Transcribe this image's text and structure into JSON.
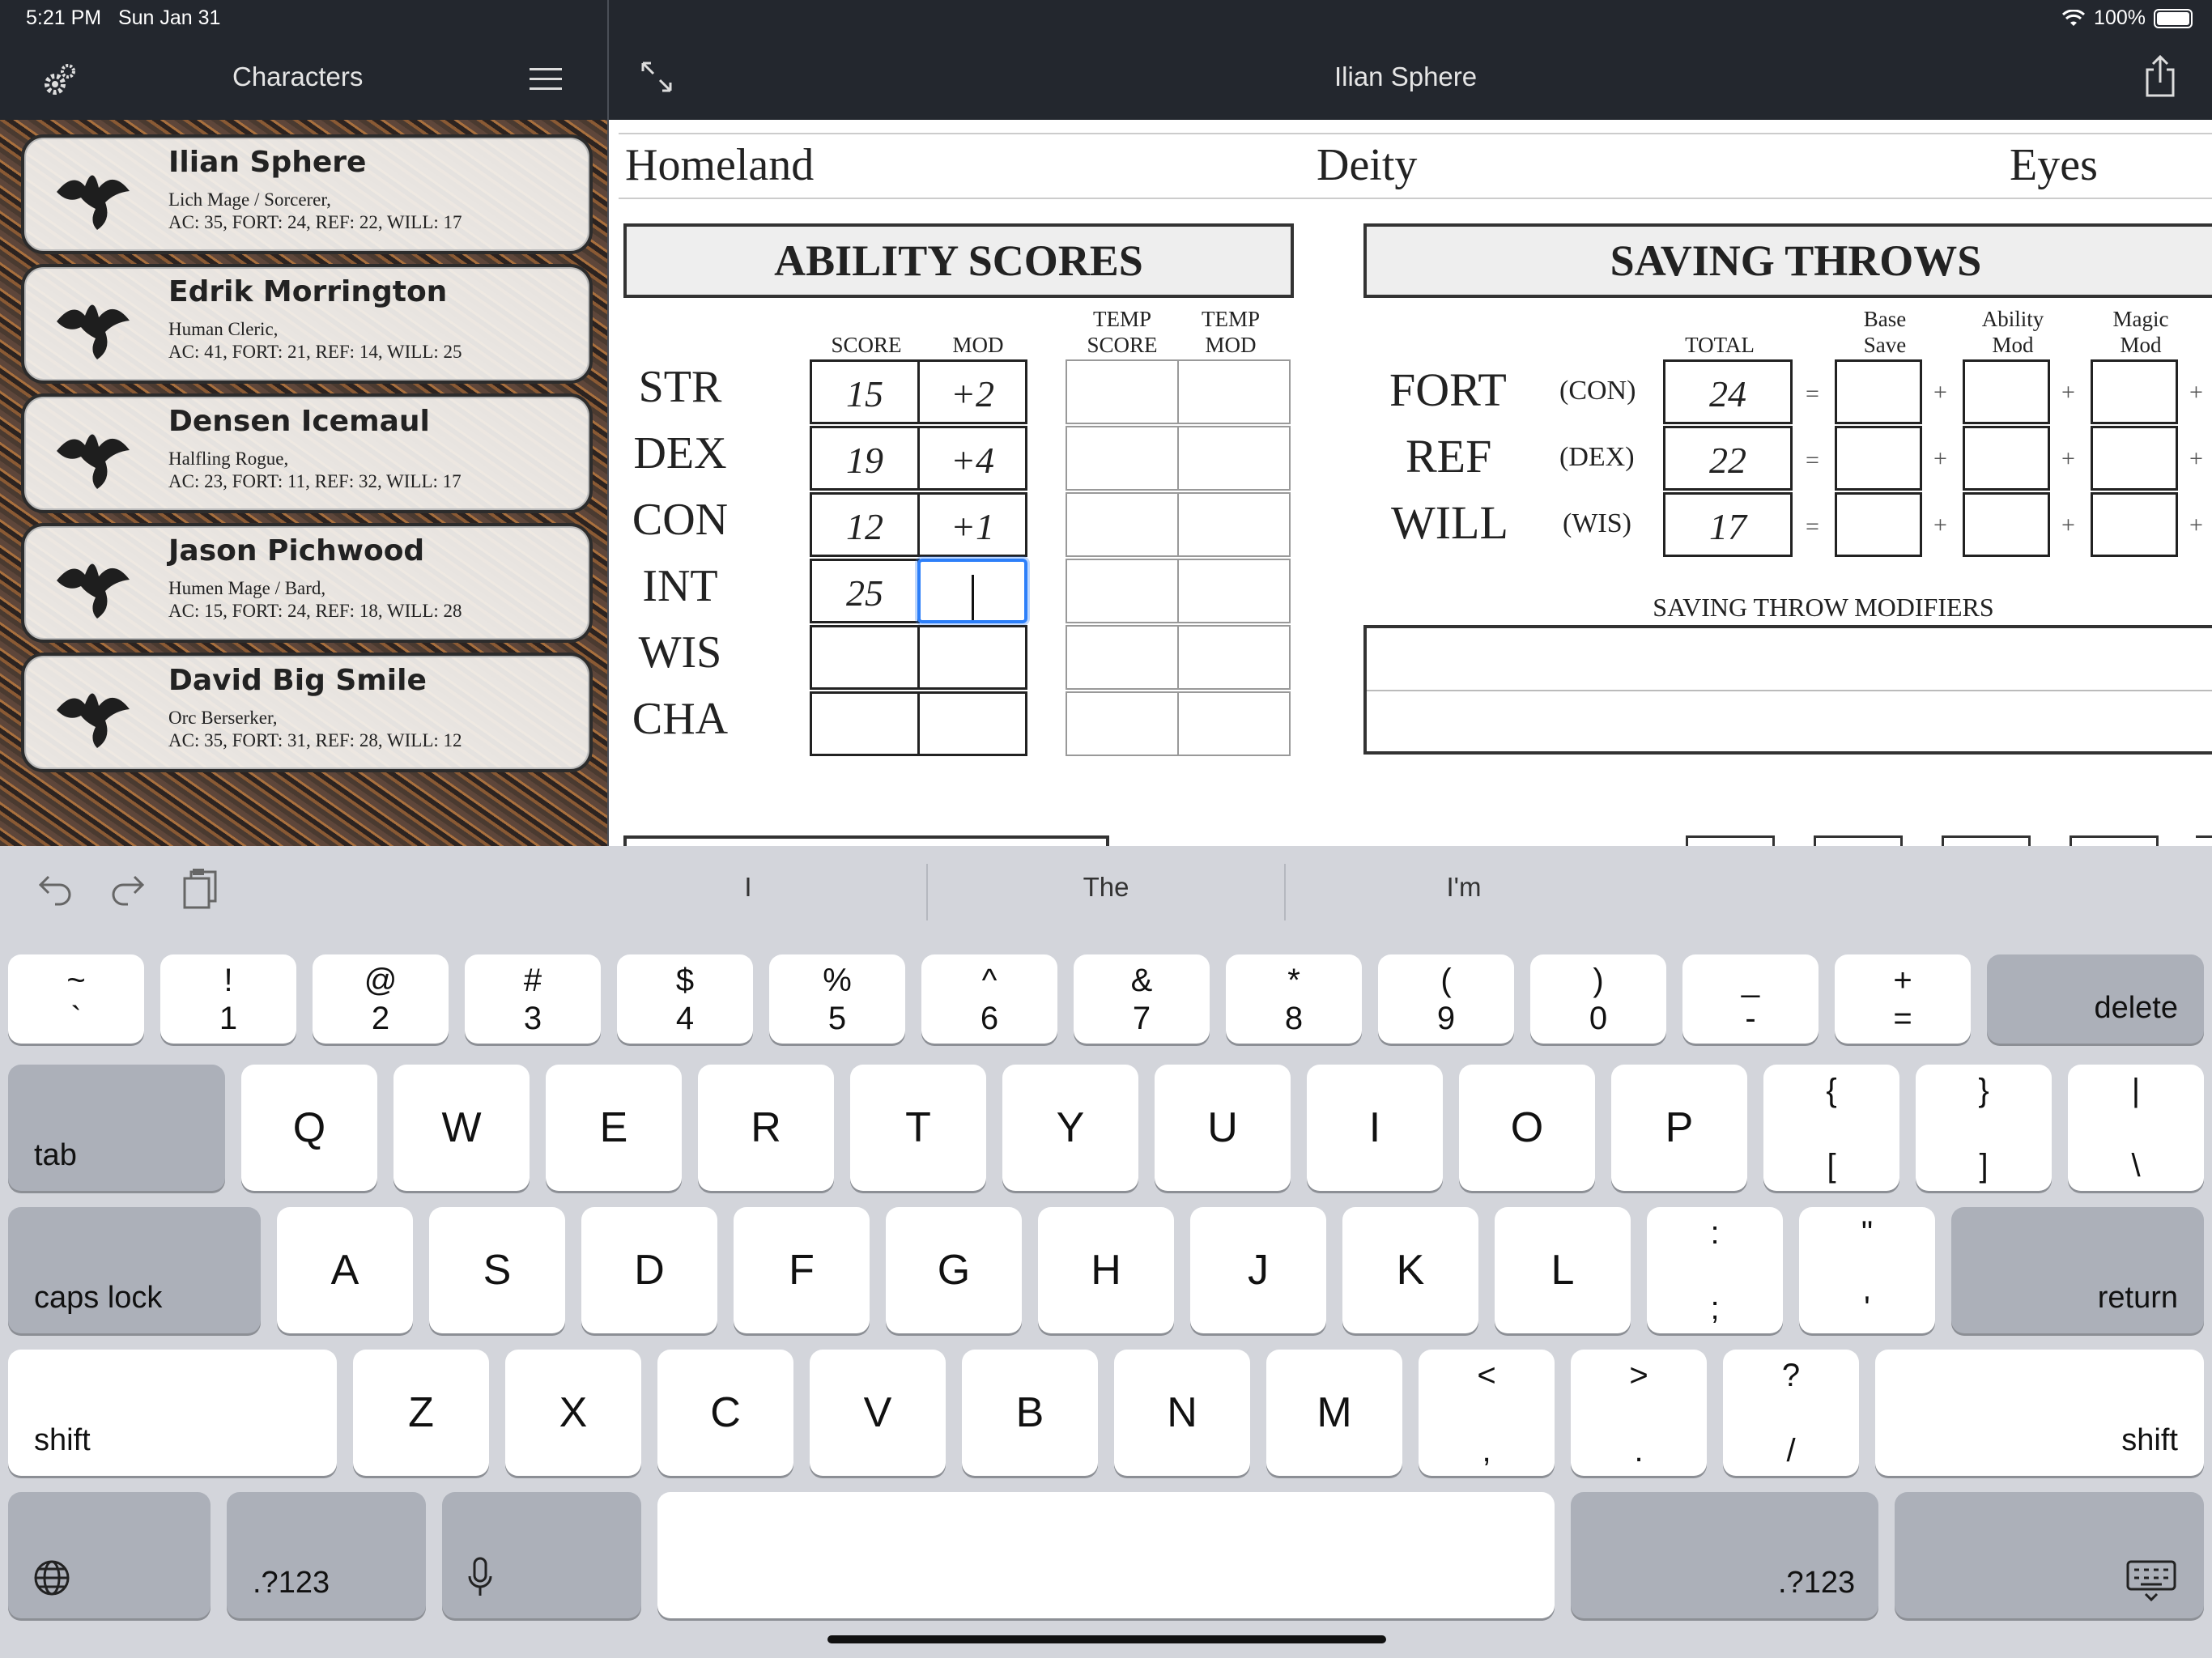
{
  "status": {
    "time": "5:21 PM",
    "date": "Sun Jan 31",
    "battery": "100%"
  },
  "sidebar": {
    "title": "Characters",
    "characters": [
      {
        "name": "Ilian Sphere",
        "desc": "Lich Mage / Sorcerer,",
        "stats": "AC: 35, FORT: 24, REF: 22, WILL: 17"
      },
      {
        "name": "Edrik Morrington",
        "desc": "Human Cleric,",
        "stats": "AC: 41, FORT: 21, REF: 14, WILL: 25"
      },
      {
        "name": "Densen Icemaul",
        "desc": "Halfling Rogue,",
        "stats": "AC: 23, FORT: 11, REF: 32, WILL: 17"
      },
      {
        "name": "Jason Pichwood",
        "desc": "Humen Mage / Bard,",
        "stats": "AC: 15, FORT: 24, REF: 18, WILL: 28"
      },
      {
        "name": "David Big Smile",
        "desc": "Orc Berserker,",
        "stats": "AC: 35, FORT: 31, REF: 28, WILL: 12"
      }
    ]
  },
  "sheet": {
    "title": "Ilian Sphere",
    "homeland": "Homeland",
    "deity": "Deity",
    "eyes": "Eyes",
    "ability_title": "ABILITY SCORES",
    "saving_title": "SAVING THROWS",
    "col_score": "SCORE",
    "col_mod": "MOD",
    "col_temp1": "TEMP",
    "col_temp_score": "SCORE",
    "col_temp2": "TEMP",
    "col_temp_mod": "MOD",
    "abilities": [
      {
        "abbr": "STR",
        "score": "15",
        "mod": "+2"
      },
      {
        "abbr": "DEX",
        "score": "19",
        "mod": "+4"
      },
      {
        "abbr": "CON",
        "score": "12",
        "mod": "+1"
      },
      {
        "abbr": "INT",
        "score": "25",
        "mod": ""
      },
      {
        "abbr": "WIS",
        "score": "",
        "mod": ""
      },
      {
        "abbr": "CHA",
        "score": "",
        "mod": ""
      }
    ],
    "save_col_total": "TOTAL",
    "save_col_base1": "Base",
    "save_col_base2": "Save",
    "save_col_ability1": "Ability",
    "save_col_ability2": "Mod",
    "save_col_magic1": "Magic",
    "save_col_magic2": "Mod",
    "saves": [
      {
        "name": "FORT",
        "ability": "(CON)",
        "total": "24"
      },
      {
        "name": "REF",
        "ability": "(DEX)",
        "total": "22"
      },
      {
        "name": "WILL",
        "ability": "(WIS)",
        "total": "17"
      }
    ],
    "ops": {
      "eq": "=",
      "plus": "+"
    },
    "save_mods_title": "SAVING THROW MODIFIERS"
  },
  "keyboard": {
    "suggestions": [
      "I",
      "The",
      "I'm"
    ],
    "row1": [
      [
        "~",
        "`"
      ],
      [
        "!",
        "1"
      ],
      [
        "@",
        "2"
      ],
      [
        "#",
        "3"
      ],
      [
        "$",
        "4"
      ],
      [
        "%",
        "5"
      ],
      [
        "^",
        "6"
      ],
      [
        "&",
        "7"
      ],
      [
        "*",
        "8"
      ],
      [
        "(",
        "9"
      ],
      [
        ")",
        "0"
      ],
      [
        "_",
        "-"
      ],
      [
        "+",
        "="
      ]
    ],
    "row2": [
      "Q",
      "W",
      "E",
      "R",
      "T",
      "Y",
      "U",
      "I",
      "O",
      "P"
    ],
    "row2_sym": [
      [
        "{",
        "["
      ],
      [
        "}",
        "]"
      ],
      [
        "|",
        "\\"
      ]
    ],
    "row3": [
      "A",
      "S",
      "D",
      "F",
      "G",
      "H",
      "J",
      "K",
      "L"
    ],
    "row3_sym": [
      [
        ":",
        ";"
      ],
      [
        "\"",
        "'"
      ]
    ],
    "row4": [
      "Z",
      "X",
      "C",
      "V",
      "B",
      "N",
      "M"
    ],
    "row4_sym": [
      [
        "<",
        ","
      ],
      [
        ">",
        "."
      ],
      [
        "?",
        "/"
      ]
    ],
    "delete": "delete",
    "tab": "tab",
    "caps": "caps lock",
    "return": "return",
    "shift": "shift",
    "num": ".?123"
  }
}
